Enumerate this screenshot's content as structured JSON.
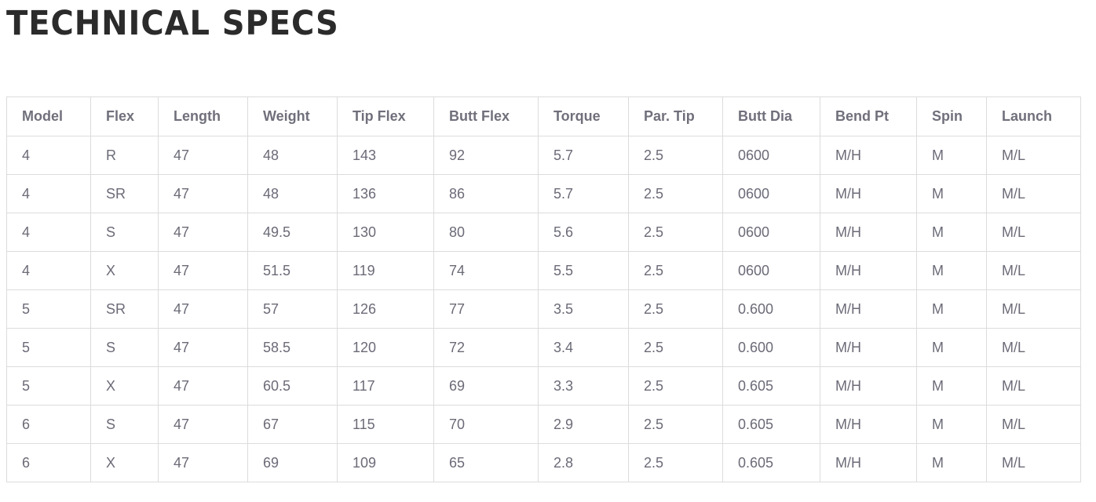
{
  "page": {
    "title": "TECHNICAL SPECS"
  },
  "table": {
    "columns": [
      "Model",
      "Flex",
      "Length",
      "Weight",
      "Tip Flex",
      "Butt Flex",
      "Torque",
      "Par. Tip",
      "Butt Dia",
      "Bend Pt",
      "Spin",
      "Launch"
    ],
    "rows": [
      [
        "4",
        "R",
        "47",
        "48",
        "143",
        "92",
        "5.7",
        "2.5",
        "0600",
        "M/H",
        "M",
        "M/L"
      ],
      [
        "4",
        "SR",
        "47",
        "48",
        "136",
        "86",
        "5.7",
        "2.5",
        "0600",
        "M/H",
        "M",
        "M/L"
      ],
      [
        "4",
        "S",
        "47",
        "49.5",
        "130",
        "80",
        "5.6",
        "2.5",
        "0600",
        "M/H",
        "M",
        "M/L"
      ],
      [
        "4",
        "X",
        "47",
        "51.5",
        "119",
        "74",
        "5.5",
        "2.5",
        "0600",
        "M/H",
        "M",
        "M/L"
      ],
      [
        "5",
        "SR",
        "47",
        "57",
        "126",
        "77",
        "3.5",
        "2.5",
        "0.600",
        "M/H",
        "M",
        "M/L"
      ],
      [
        "5",
        "S",
        "47",
        "58.5",
        "120",
        "72",
        "3.4",
        "2.5",
        "0.600",
        "M/H",
        "M",
        "M/L"
      ],
      [
        "5",
        "X",
        "47",
        "60.5",
        "117",
        "69",
        "3.3",
        "2.5",
        "0.605",
        "M/H",
        "M",
        "M/L"
      ],
      [
        "6",
        "S",
        "47",
        "67",
        "115",
        "70",
        "2.9",
        "2.5",
        "0.605",
        "M/H",
        "M",
        "M/L"
      ],
      [
        "6",
        "X",
        "47",
        "69",
        "109",
        "65",
        "2.8",
        "2.5",
        "0.605",
        "M/H",
        "M",
        "M/L"
      ]
    ]
  }
}
